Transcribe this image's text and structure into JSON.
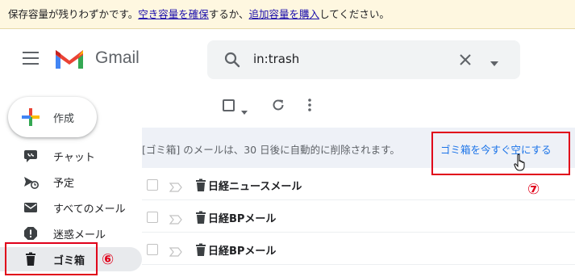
{
  "warning": {
    "prefix": "保存容量が残りわずかです。",
    "link1": "空き容量を確保",
    "middle": "するか、",
    "link2": "追加容量を購入",
    "suffix": "してください。"
  },
  "header": {
    "brand": "Gmail",
    "search_value": "in:trash"
  },
  "compose": {
    "label": "作成"
  },
  "sidebar": {
    "items": [
      {
        "label": "チャット",
        "icon": "chat-icon"
      },
      {
        "label": "予定",
        "icon": "scheduled-icon"
      },
      {
        "label": "すべてのメール",
        "icon": "mail-icon"
      },
      {
        "label": "迷惑メール",
        "icon": "spam-icon"
      },
      {
        "label": "ゴミ箱",
        "icon": "trash-icon",
        "active": true
      }
    ]
  },
  "annotations": {
    "six": "⑥",
    "seven": "⑦"
  },
  "banner": {
    "text": "[ゴミ箱] のメールは、30 日後に自動的に削除されます。",
    "action": "ゴミ箱を今すぐ空にする"
  },
  "emails": [
    {
      "sender": "日経ニュースメール"
    },
    {
      "sender": "日経BPメール"
    },
    {
      "sender": "日経BPメール"
    }
  ],
  "colors": {
    "accent": "#1a73e8",
    "annotation_red": "#e0001a",
    "warning_bg": "#fef7e0"
  }
}
